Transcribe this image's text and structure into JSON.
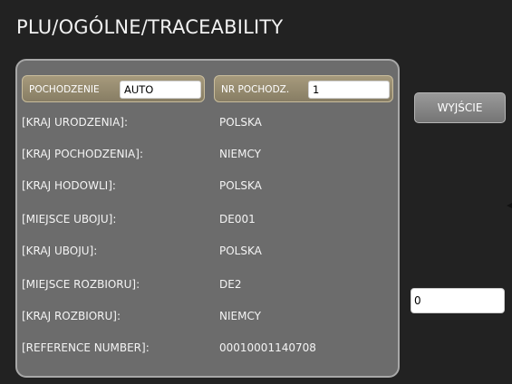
{
  "header": {
    "title": "PLU/OGÓLNE/TRACEABILITY"
  },
  "origin": {
    "origin_label": "POCHODZENIE",
    "origin_value": "AUTO",
    "origin_no_label": "NR POCHODZ.",
    "origin_no_value": "1"
  },
  "rows": [
    {
      "label": "[KRAJ URODZENIA]:",
      "value": "POLSKA"
    },
    {
      "label": "[KRAJ POCHODZENIA]:",
      "value": "NIEMCY"
    },
    {
      "label": "[KRAJ HODOWLI]:",
      "value": "POLSKA"
    },
    {
      "label": "[MIEJSCE UBOJU]:",
      "value": "DE001"
    },
    {
      "label": "[KRAJ UBOJU]:",
      "value": "POLSKA"
    },
    {
      "label": "[MIEJSCE ROZBIORU]:",
      "value": "DE2"
    },
    {
      "label": "[KRAJ ROZBIORU]:",
      "value": "NIEMCY"
    },
    {
      "label": "[REFERENCE NUMBER]:",
      "value": "00010001140708"
    }
  ],
  "side": {
    "exit_label": "WYJŚCIE",
    "number_value": "0"
  },
  "colors": {
    "background": "#222222",
    "panel": "#6c6c6c",
    "origin_field": "#9a8f72",
    "button": "#858585"
  },
  "icons": {
    "edge_marker": "triangle-left-icon"
  }
}
